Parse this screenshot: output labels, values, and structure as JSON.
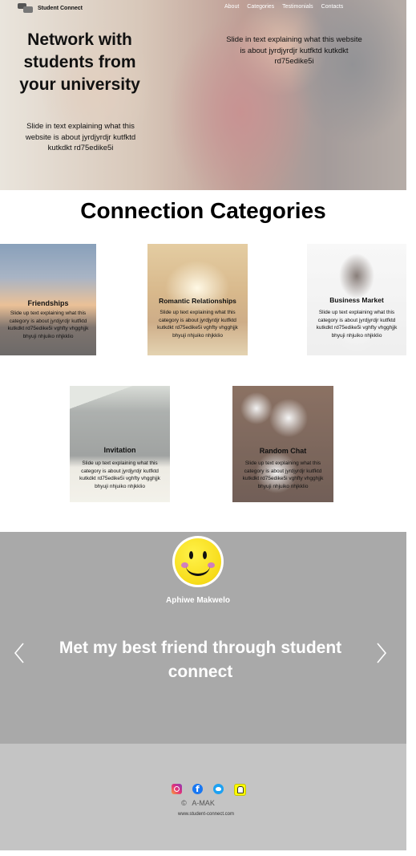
{
  "header": {
    "brand": "Student Connect",
    "nav": [
      "About",
      "Categories",
      "Testimonials",
      "Contacts"
    ]
  },
  "hero": {
    "headline": "Network with students from your university",
    "blurb_right": "Slide in text explaining what this website is about jyrdjyrdjr kutfktd kutkdkt rd75edike5i",
    "blurb_left": "Slide in text explaining what this website is about jyrdjyrdjr kutfktd kutkdkt rd75edike5i"
  },
  "categories": {
    "title": "Connection Categories",
    "items": [
      {
        "name": "Friendships",
        "text": "Slide up text explaining what this category is about jyrdjyrdjr kutfktd kutkdkt rd75edike5i vghfty vhgghjjk bhyuji nhjuiko nhjkklio"
      },
      {
        "name": "Romantic Relationships",
        "text": "Slide up text explaining what this category is about jyrdjyrdjr kutfktd kutkdkt rd75edike5i vghfty vhgghjjk bhyuji nhjuiko nhjkklio"
      },
      {
        "name": "Business Market",
        "text": "Slide up text explaining what this category is about jyrdjyrdjr kutfktd kutkdkt rd75edike5i vghfty vhgghjjk bhyuji nhjuiko nhjkklio"
      },
      {
        "name": "Invitation",
        "text": "Slide up text explaining what this category is about jyrdjyrdjr kutfktd kutkdkt rd75edike5i vghfty vhgghjjk bhyuji nhjuiko nhjkklio"
      },
      {
        "name": "Random Chat",
        "text": "Slide up text explaining what this category is about jyrdjyrdjr kutfktd kutkdkt rd75edike5i vghfty vhgghjjk bhyuji nhjuiko nhjkklio"
      }
    ]
  },
  "testimonial": {
    "name": "Aphiwe Makwelo",
    "quote": "Met my best friend through student connect"
  },
  "footer": {
    "copyright_symbol": "©",
    "copyright_name": "A-MAK",
    "website": "www.student-connect.com",
    "social": [
      "instagram-icon",
      "facebook-icon",
      "twitter-icon",
      "snapchat-icon"
    ]
  },
  "colors": {
    "testimonial_bg": "#a9a9a9",
    "footer_bg": "#c4c4c4",
    "avatar_yellow": "#f7dc1a"
  }
}
